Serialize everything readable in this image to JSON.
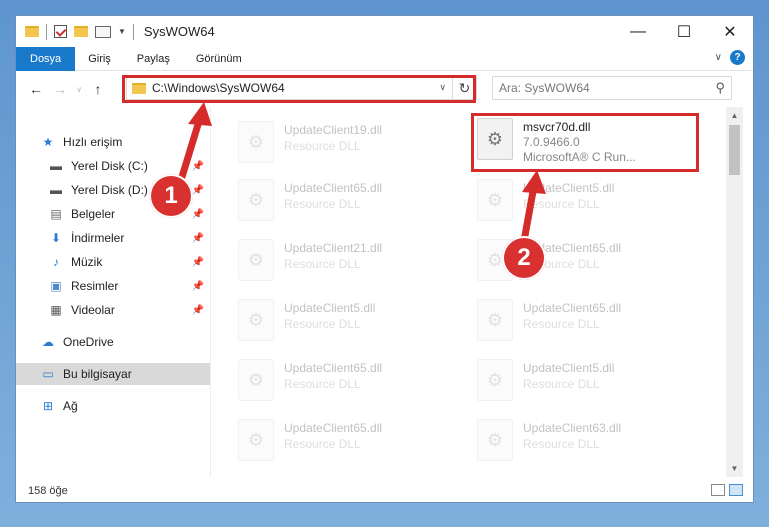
{
  "window": {
    "title": "SysWOW64",
    "controls": {
      "minimize": "—",
      "maximize": "☐",
      "close": "✕"
    }
  },
  "ribbon": {
    "tabs": [
      "Dosya",
      "Giriş",
      "Paylaş",
      "Görünüm"
    ],
    "help_label": "?"
  },
  "nav": {
    "back": "←",
    "forward": "→",
    "up": "↑",
    "address": "C:\\Windows\\SysWOW64",
    "refresh": "↻",
    "search_placeholder": "Ara: SysWOW64"
  },
  "sidebar": {
    "quick_access": "Hızlı erişim",
    "items": [
      {
        "label": "Yerel Disk (C:)",
        "icon": "drive-icon"
      },
      {
        "label": "Yerel Disk (D:)",
        "icon": "drive-icon"
      },
      {
        "label": "Belgeler",
        "icon": "documents-icon"
      },
      {
        "label": "İndirmeler",
        "icon": "download-icon"
      },
      {
        "label": "Müzik",
        "icon": "music-icon"
      },
      {
        "label": "Resimler",
        "icon": "pictures-icon"
      },
      {
        "label": "Videolar",
        "icon": "videos-icon"
      }
    ],
    "onedrive": "OneDrive",
    "this_pc": "Bu bilgisayar",
    "network": "Ağ"
  },
  "files": {
    "highlight": {
      "name": "msvcr70d.dll",
      "version": "7.0.9466.0",
      "company": "MicrosoftA® C Run..."
    },
    "left": [
      {
        "name": "UpdateClient19.dll",
        "type": "Resource DLL"
      },
      {
        "name": "UpdateClient65.dll",
        "type": "Resource DLL"
      },
      {
        "name": "UpdateClient21.dll",
        "type": "Resource DLL"
      },
      {
        "name": "UpdateClient5.dll",
        "type": "Resource DLL"
      },
      {
        "name": "UpdateClient65.dll",
        "type": "Resource DLL"
      },
      {
        "name": "UpdateClient65.dll",
        "type": "Resource DLL"
      }
    ],
    "right": [
      {
        "name": "UpdateClient5.dll",
        "type": "Resource DLL"
      },
      {
        "name": "UpdateClient65.dll",
        "type": "Resource DLL"
      },
      {
        "name": "UpdateClient65.dll",
        "type": "Resource DLL"
      },
      {
        "name": "UpdateClient5.dll",
        "type": "Resource DLL"
      },
      {
        "name": "UpdateClient63.dll",
        "type": "Resource DLL"
      }
    ]
  },
  "status": {
    "count": "158 öğe"
  },
  "callouts": {
    "one": "1",
    "two": "2"
  },
  "colors": {
    "accent": "#1979ca",
    "annotation": "#d62b2b"
  }
}
